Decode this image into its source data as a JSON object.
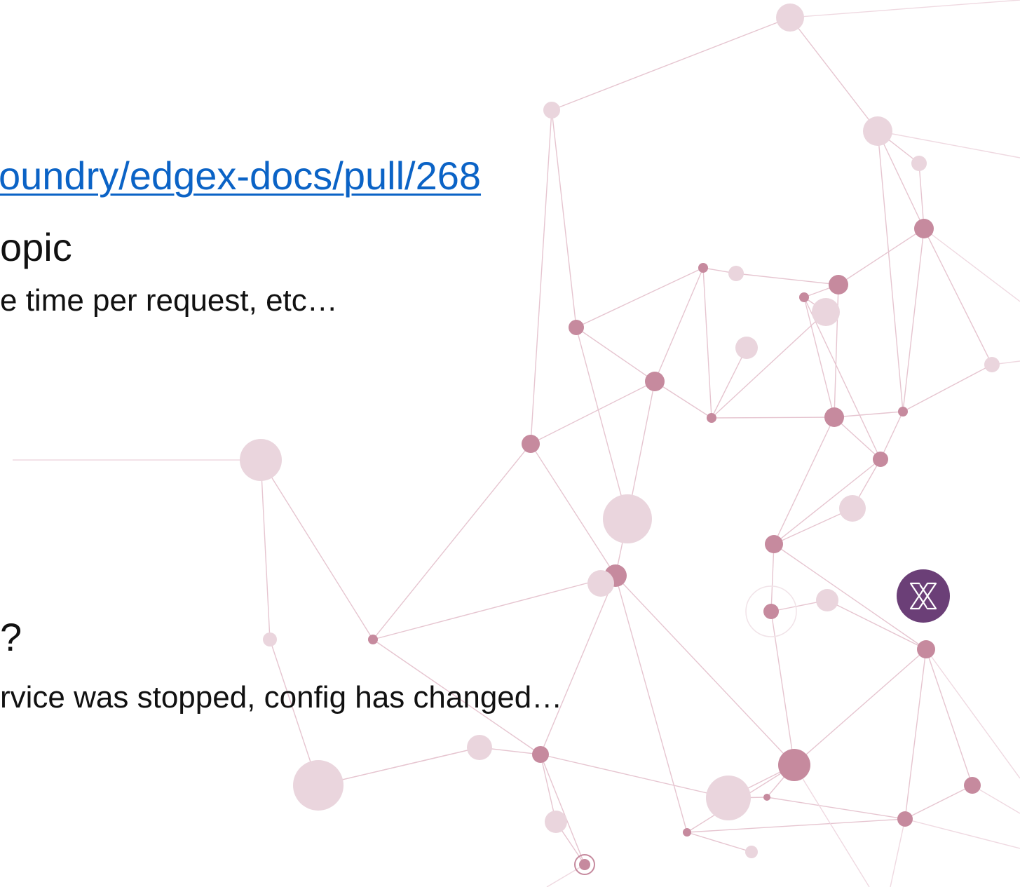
{
  "slide": {
    "link_text": "oundry/edgex-docs/pull/268",
    "topic_text": "opic",
    "time_text": "e time per request, etc…",
    "question_text": "?",
    "service_text": "rvice was stopped, config has changed…"
  },
  "colors": {
    "link": "#0b63c6",
    "node_dark": "#c68a9e",
    "node_light": "#ead5dd",
    "edge": "#e4bfcb",
    "logo_bg": "#6b3f77"
  },
  "logo": {
    "icon": "x-logo-icon"
  }
}
